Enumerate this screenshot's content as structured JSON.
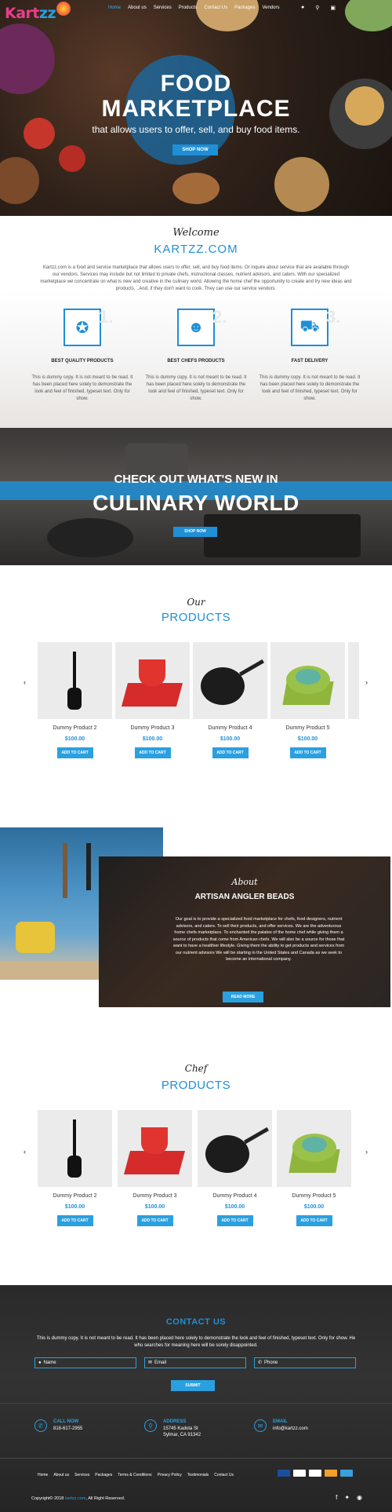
{
  "brand": {
    "logo_text_pink": "Kart",
    "logo_text_blue": "zz"
  },
  "nav": {
    "items": [
      "Home",
      "About us",
      "Services",
      "Products",
      "Contact Us",
      "Packages",
      "Vendors"
    ],
    "icons": [
      "user-icon",
      "search-icon",
      "cart-icon"
    ]
  },
  "hero": {
    "title_line1": "FOOD",
    "title_line2": "MARKETPLACE",
    "subtitle": "that allows users to offer, sell, and buy food items.",
    "button": "SHOP NOW"
  },
  "welcome": {
    "script": "Welcome",
    "title": "KARTZZ.COM",
    "text": "Kartzz.com is a food and service marketplace that allows users to offer, sell, and buy food items. Or inquire about service that are available through our vendors. Services may include but not limited to private chefs, instructional classes, nutrient advisors, and caters. With our specialized marketplace we concentrate on what is new and creative in the culinary world. Allowing the home chef the opportunity to create and try new ideas and products. ..And, if they don't want to cook. They can use our service vendors.",
    "features": [
      {
        "num": "1.",
        "icon": "award-icon",
        "title": "BEST QUALITY PRODUCTS",
        "text": "This is dummy copy. It is not meant to be read. It has been placed here solely to demonstrate the look and feel of finished, typeset text. Only for show."
      },
      {
        "num": "2.",
        "icon": "chef-icon",
        "title": "BEST CHEFS PRODUCTS",
        "text": "This is dummy copy. It is not meant to be read. It has been placed here solely to demonstrate the look and feel of finished, typeset text. Only for show."
      },
      {
        "num": "3.",
        "icon": "truck-icon",
        "title": "FAST DELIVERY",
        "text": "This is dummy copy. It is not meant to be read. It has been placed here solely to demonstrate the look and feel of finished, typeset text. Only for show."
      }
    ]
  },
  "culinary": {
    "line1": "CHECK OUT WHAT'S NEW IN",
    "line2": "CULINARY WORLD",
    "button": "SHOP NOW"
  },
  "products": {
    "script": "Our",
    "title": "PRODUCTS",
    "items": [
      {
        "name": "Dummy Product 2",
        "price": "$100.00",
        "button": "ADD TO CART",
        "icon": "spaghetti-spoon-icon"
      },
      {
        "name": "Dummy Product 3",
        "price": "$100.00",
        "button": "ADD TO CART",
        "icon": "red-cups-icon"
      },
      {
        "name": "Dummy Product 4",
        "price": "$100.00",
        "button": "ADD TO CART",
        "icon": "frying-pan-icon"
      },
      {
        "name": "Dummy Product 5",
        "price": "$100.00",
        "button": "ADD TO CART",
        "icon": "green-plates-icon"
      }
    ]
  },
  "about": {
    "script": "About",
    "title": "ARTISAN ANGLER BEADS",
    "text": "Our goal is to provide a specialized food marketplace for chefs, food designers, nutrient advisors, and caters. To sell their products, and offer services.  We are the adventurous home chefs marketplace. To enchanted the palates of the home chef while giving them a source of products that come from American chefs. We will also be a source for those that want to have a healthier lifestyle. Giving them the ability to get products and services from our nutrient advisors We will be starting in the United States and Canada as we seek to become an international company.",
    "button": "READ MORE"
  },
  "chef_products": {
    "script": "Chef",
    "title": "PRODUCTS",
    "items": [
      {
        "name": "Dummy Product 2",
        "price": "$100.00",
        "button": "ADD TO CART",
        "icon": "spaghetti-spoon-icon"
      },
      {
        "name": "Dummy Product 3",
        "price": "$100.00",
        "button": "ADD TO CART",
        "icon": "red-cups-icon"
      },
      {
        "name": "Dummy Product 4",
        "price": "$100.00",
        "button": "ADD TO CART",
        "icon": "frying-pan-icon"
      },
      {
        "name": "Dummy Product 5",
        "price": "$100.00",
        "button": "ADD TO CART",
        "icon": "green-plates-icon"
      }
    ]
  },
  "contact": {
    "title": "CONTACT US",
    "text": "This is dummy copy. It is not meant to be read. It has been placed here solely to demonstrate the look and feel of finished, typeset text. Only for show. He who searches for meaning here will be sorely disappointed.",
    "name_placeholder": "Name",
    "email_placeholder": "Email",
    "phone_placeholder": "Phone",
    "submit": "SUBMIT",
    "call_label": "CALL NOW",
    "call_value": "818-617-2955",
    "address_label": "ADDRESS",
    "address_line1": "15745 Kadota St",
    "address_line2": "Sylmar, CA 91342",
    "email_label": "EMAIL",
    "email_value": "info@kartzz.com"
  },
  "footer": {
    "links": [
      "Home",
      "About us",
      "Services",
      "Packages",
      "Terms & Conditions",
      "Privacy Policy",
      "Testimonials",
      "Contact Us"
    ],
    "copy_prefix": "Copyright© 2018",
    "copy_link": "kartzz.com",
    "copy_suffix": ", All Right Reserved.",
    "payments": [
      "visa-icon",
      "paypal-icon",
      "discover-icon",
      "mastercard-icon",
      "amex-icon"
    ],
    "social": [
      "facebook-icon",
      "twitter-icon",
      "instagram-icon"
    ]
  },
  "colors": {
    "accent": "#1f8fd6",
    "button": "#2aa0e0",
    "logo_pink": "#e83e8c"
  }
}
